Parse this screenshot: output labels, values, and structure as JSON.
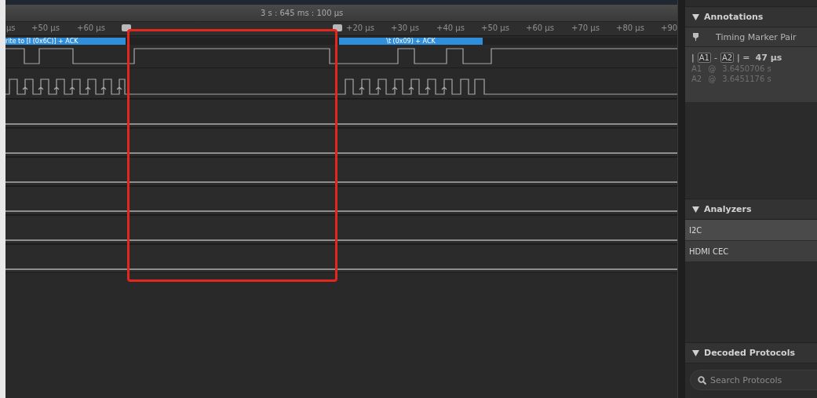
{
  "timeline": {
    "title": "3 s : 645 ms : 100 µs",
    "ticks": [
      "µs",
      "+50 µs",
      "+60 µs",
      "+20 µs",
      "+30 µs",
      "+40 µs",
      "+50 µs",
      "+60 µs",
      "+70 µs",
      "+80 µs",
      "+90"
    ]
  },
  "channels": [
    {
      "kind": "data",
      "decoded": [
        {
          "text": "rite to [I (0x6C)] + ACK"
        },
        {
          "text": "\\t (0x09) + ACK"
        }
      ]
    },
    {
      "kind": "clock"
    },
    {
      "kind": "idle"
    },
    {
      "kind": "idle"
    },
    {
      "kind": "idle"
    },
    {
      "kind": "idle"
    },
    {
      "kind": "idle"
    },
    {
      "kind": "idle"
    }
  ],
  "annotations": {
    "title": "Annotations",
    "expanded": true,
    "item": "Timing Marker Pair",
    "measurement": {
      "open": "|",
      "a": "A1",
      "dash": "-",
      "b": "A2",
      "close": "| =",
      "value": "47 µs"
    },
    "markers": [
      {
        "name": "A1",
        "at": "@",
        "time": "3.6450706 s"
      },
      {
        "name": "A2",
        "at": "@",
        "time": "3.6451176 s"
      }
    ]
  },
  "analyzers": {
    "title": "Analyzers",
    "expanded": true,
    "items": [
      {
        "name": "I2C",
        "selected": true
      },
      {
        "name": "HDMI CEC",
        "selected": false
      }
    ]
  },
  "decoded_protocols": {
    "title": "Decoded Protocols",
    "expanded": true,
    "search": {
      "placeholder": "Search Protocols"
    }
  }
}
